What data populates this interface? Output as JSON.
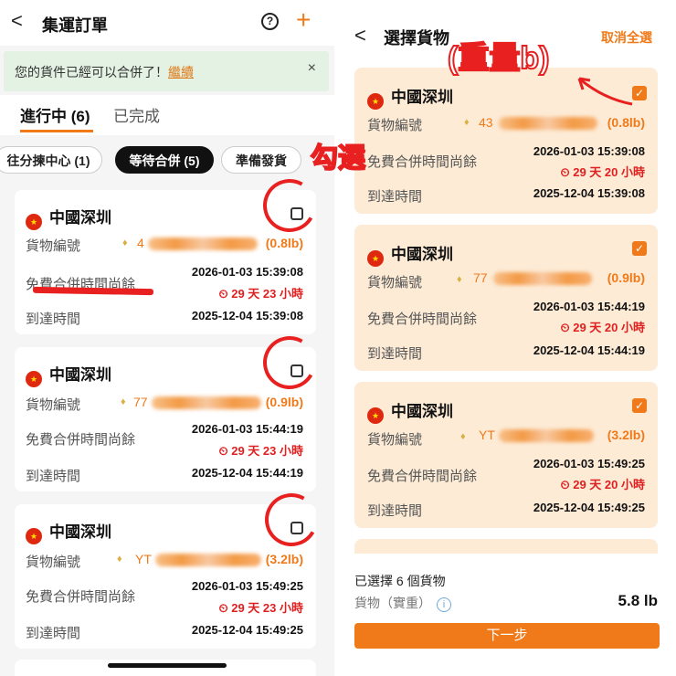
{
  "left": {
    "title": "集運訂單",
    "back": "<",
    "help": "?",
    "add": "+",
    "banner": {
      "text": "您的貨件已經可以合併了！",
      "link": "繼續",
      "close": "×"
    },
    "tabs": {
      "active": "進行中 (6)",
      "done": "已完成"
    },
    "chips": [
      "往分揀中心 (1)",
      "等待合併 (5)",
      "準備發貨"
    ],
    "cards": [
      {
        "origin": "中國深圳",
        "track_label": "貨物編號",
        "track_prefix": "4",
        "weight": "(0.8lb)",
        "free_label": "免費合併時間尚餘",
        "free_until": "2026-01-03 15:39:08",
        "countdown": "29 天 23 小時",
        "arrive_label": "到達時間",
        "arrived": "2025-12-04 15:39:08"
      },
      {
        "origin": "中國深圳",
        "track_label": "貨物編號",
        "track_prefix": "77",
        "weight": "(0.9lb)",
        "free_label": "免費合併時間尚餘",
        "free_until": "2026-01-03 15:44:19",
        "countdown": "29 天 23 小時",
        "arrive_label": "到達時間",
        "arrived": "2025-12-04 15:44:19"
      },
      {
        "origin": "中國深圳",
        "track_label": "貨物編號",
        "track_prefix": "YT",
        "weight": "(3.2lb)",
        "free_label": "免費合併時間尚餘",
        "free_until": "2026-01-03 15:49:25",
        "countdown": "29 天 23 小時",
        "arrive_label": "到達時間",
        "arrived": "2025-12-04 15:49:25"
      }
    ]
  },
  "right": {
    "title": "選擇貨物",
    "back": "<",
    "cancel_all": "取消全選",
    "cards": [
      {
        "origin": "中國深圳",
        "track_label": "貨物編號",
        "track_prefix": "43",
        "weight": "(0.8lb)",
        "free_label": "免費合併時間尚餘",
        "free_until": "2026-01-03 15:39:08",
        "countdown": "29 天 20 小時",
        "arrive_label": "到達時間",
        "arrived": "2025-12-04 15:39:08"
      },
      {
        "origin": "中國深圳",
        "track_label": "貨物編號",
        "track_prefix": "77",
        "weight": "(0.9lb)",
        "free_label": "免費合併時間尚餘",
        "free_until": "2026-01-03 15:44:19",
        "countdown": "29 天 20 小時",
        "arrive_label": "到達時間",
        "arrived": "2025-12-04 15:44:19"
      },
      {
        "origin": "中國深圳",
        "track_label": "貨物編號",
        "track_prefix": "YT",
        "weight": "(3.2lb)",
        "free_label": "免費合併時間尚餘",
        "free_until": "2026-01-03 15:49:25",
        "countdown": "29 天 20 小時",
        "arrive_label": "到達時間",
        "arrived": "2025-12-04 15:49:25"
      }
    ],
    "footer": {
      "selected": "已選擇 6 個貨物",
      "goods_label": "貨物（實重）",
      "info": "i",
      "total": "5.8 lb",
      "next": "下一步"
    }
  },
  "annotations": {
    "check": "勾選",
    "weight": "(重量b)"
  },
  "colors": {
    "accent": "#f07a1a",
    "annotation": "#e82020",
    "banner_bg": "#e3f2e3",
    "selected_card_bg": "#fdebd6"
  }
}
